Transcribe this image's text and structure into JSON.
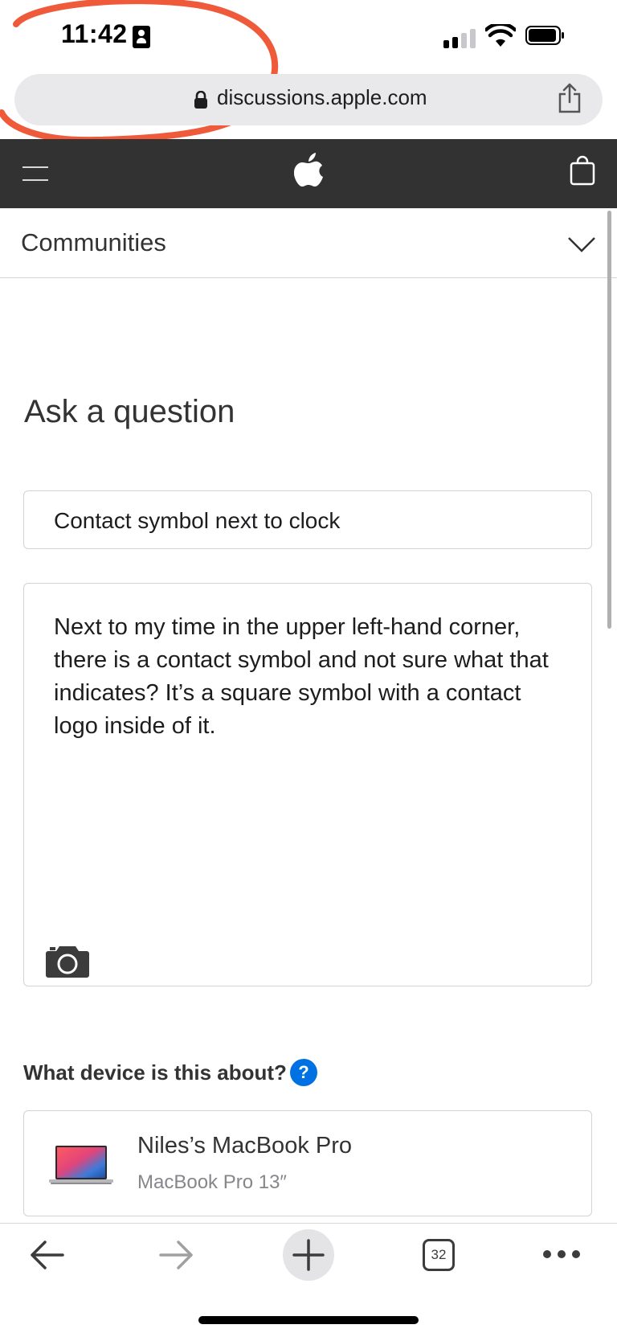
{
  "status_bar": {
    "time": "11:42",
    "status_icon": "contact-card-icon",
    "signal_icon": "cellular-signal-icon",
    "wifi_icon": "wifi-icon",
    "battery_icon": "battery-icon"
  },
  "annotation": {
    "type": "hand-drawn circle around time",
    "color": "#ef5b3a"
  },
  "address_bar": {
    "url": "discussions.apple.com",
    "lock_icon": "lock-icon",
    "share_icon": "share-icon"
  },
  "global_nav": {
    "menu_icon": "hamburger-menu-icon",
    "logo_icon": "apple-logo-icon",
    "bag_icon": "shopping-bag-icon",
    "background": "#323232"
  },
  "communities_bar": {
    "label": "Communities",
    "chevron_icon": "chevron-down-icon"
  },
  "page": {
    "title": "Ask a question"
  },
  "question_form": {
    "subject": "Contact symbol next to clock",
    "body": "Next to my time in the upper left-hand corner, there is a contact symbol and not sure what that indicates? It’s a square symbol with a contact logo inside of it.",
    "attach_icon": "camera-icon",
    "device_question": "What device is this about?",
    "help_label": "?",
    "help_color": "#0071e3",
    "device": {
      "name": "Niles’s MacBook Pro",
      "model": "MacBook Pro 13″",
      "image_icon": "macbook-pro-image"
    }
  },
  "toolbar": {
    "back_icon": "arrow-left-icon",
    "forward_icon": "arrow-right-icon",
    "new_tab_icon": "plus-icon",
    "tabs_count": "32",
    "more_icon": "more-dots-icon"
  }
}
